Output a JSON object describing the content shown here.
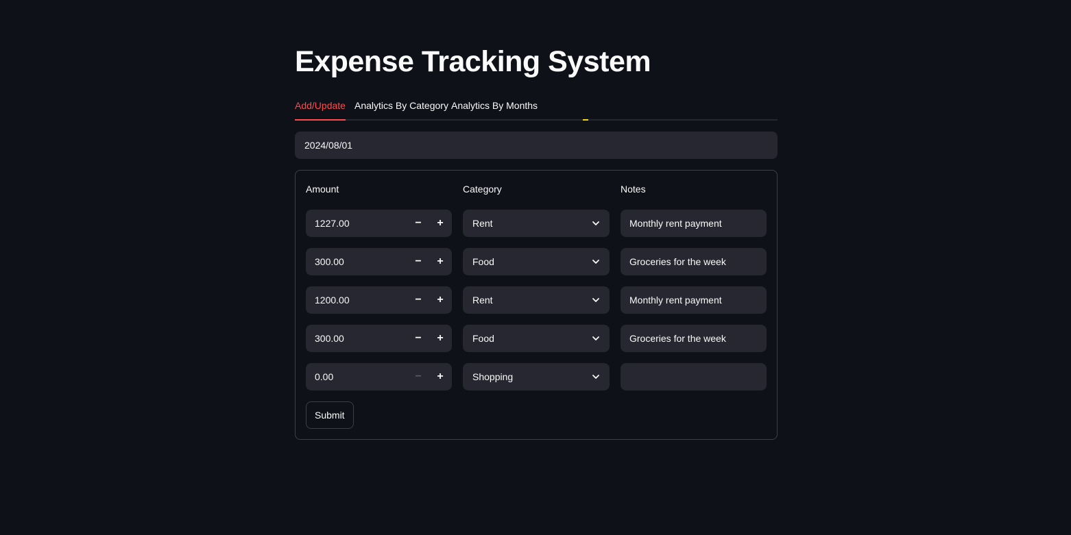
{
  "page": {
    "title": "Expense Tracking System"
  },
  "tabs": [
    {
      "label": "Add/Update",
      "active": true
    },
    {
      "label": "Analytics By Category",
      "active": false
    },
    {
      "label": "Analytics By Months",
      "active": false
    }
  ],
  "date_input": {
    "value": "2024/08/01"
  },
  "form": {
    "labels": {
      "amount": "Amount",
      "category": "Category",
      "notes": "Notes"
    },
    "rows": [
      {
        "amount": "1227.00",
        "category": "Rent",
        "notes": "Monthly rent payment"
      },
      {
        "amount": "300.00",
        "category": "Food",
        "notes": "Groceries for the week"
      },
      {
        "amount": "1200.00",
        "category": "Rent",
        "notes": "Monthly rent payment"
      },
      {
        "amount": "300.00",
        "category": "Food",
        "notes": "Groceries for the week"
      },
      {
        "amount": "0.00",
        "category": "Shopping",
        "notes": ""
      }
    ],
    "stepper": {
      "minus": "−",
      "plus": "+"
    },
    "submit_label": "Submit"
  },
  "colors": {
    "background": "#0e1117",
    "input_bg": "#262730",
    "accent": "#ff4b4b",
    "text": "#fafafa"
  },
  "icons": {
    "select_chevron": "chevron-down-icon"
  }
}
